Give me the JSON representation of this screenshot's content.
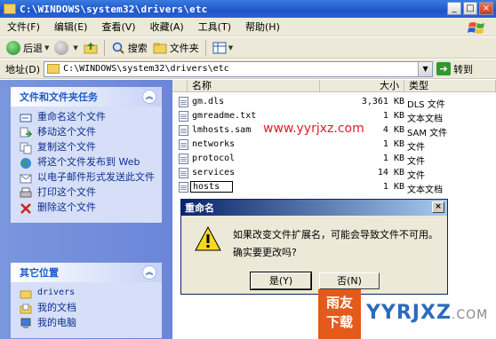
{
  "window": {
    "title": "C:\\WINDOWS\\system32\\drivers\\etc",
    "buttons": [
      "_",
      "□",
      "×"
    ]
  },
  "menu": [
    "文件(F)",
    "编辑(E)",
    "查看(V)",
    "收藏(A)",
    "工具(T)",
    "帮助(H)"
  ],
  "toolbar": {
    "back": "后退",
    "search": "搜索",
    "folders": "文件夹"
  },
  "address": {
    "label": "地址(D)",
    "path": "C:\\WINDOWS\\system32\\drivers\\etc",
    "go": "转到"
  },
  "tasks_panel": {
    "title": "文件和文件夹任务",
    "items": [
      "重命名这个文件",
      "移动这个文件",
      "复制这个文件",
      "将这个文件发布到 Web",
      "以电子邮件形式发送此文件",
      "打印这个文件",
      "删除这个文件"
    ]
  },
  "places_panel": {
    "title": "其它位置",
    "items": [
      "drivers",
      "我的文档",
      "我的电脑"
    ]
  },
  "columns": {
    "name": "名称",
    "size": "大小",
    "type": "类型"
  },
  "files": [
    {
      "name": "gm.dls",
      "size": "3,361 KB",
      "type": "DLS 文件"
    },
    {
      "name": "gmreadme.txt",
      "size": "1 KB",
      "type": "文本文档"
    },
    {
      "name": "lmhosts.sam",
      "size": "4 KB",
      "type": "SAM 文件"
    },
    {
      "name": "networks",
      "size": "1 KB",
      "type": "文件"
    },
    {
      "name": "protocol",
      "size": "1 KB",
      "type": "文件"
    },
    {
      "name": "services",
      "size": "14 KB",
      "type": "文件"
    },
    {
      "name": "hosts",
      "size": "1 KB",
      "type": "文本文档"
    }
  ],
  "watermark": "www.yyrjxz.com",
  "dialog": {
    "title": "重命名",
    "line1": "如果改变文件扩展名，可能会导致文件不可用。",
    "line2": "确实要更改吗?",
    "yes": "是(Y)",
    "no": "否(N)"
  },
  "brand": {
    "badge_top": "雨友",
    "badge_bottom": "下载",
    "text": "YYRJXZ",
    "suffix": ".COM"
  }
}
